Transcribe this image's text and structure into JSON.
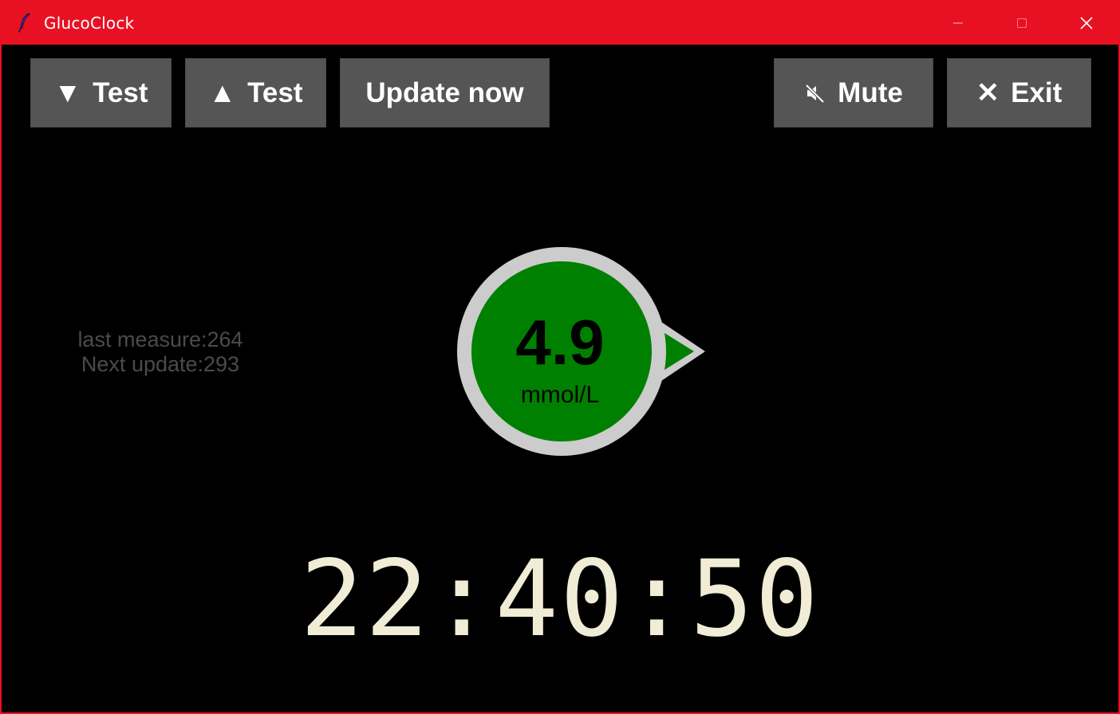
{
  "window": {
    "title": "GlucoClock",
    "icon": "feather-icon",
    "titlebar_color": "#e81123"
  },
  "toolbar": {
    "test_down": {
      "glyph": "▼",
      "label": "Test"
    },
    "test_up": {
      "glyph": "▲",
      "label": "Test"
    },
    "update_now": {
      "label": "Update now"
    },
    "mute": {
      "icon": "speaker-muted-icon",
      "label": "Mute"
    },
    "exit": {
      "glyph": "✕",
      "label": "Exit"
    }
  },
  "status": {
    "last_measure": "last measure:264",
    "next_update": "Next update:293"
  },
  "reading": {
    "value": "4.9",
    "unit": "mmol/L",
    "trend_icon": "trend-right-arrow-icon",
    "status_color": "#008000",
    "ring_color": "#cccccc"
  },
  "clock": {
    "time": "22:40:50",
    "color": "#f0ecd6"
  }
}
